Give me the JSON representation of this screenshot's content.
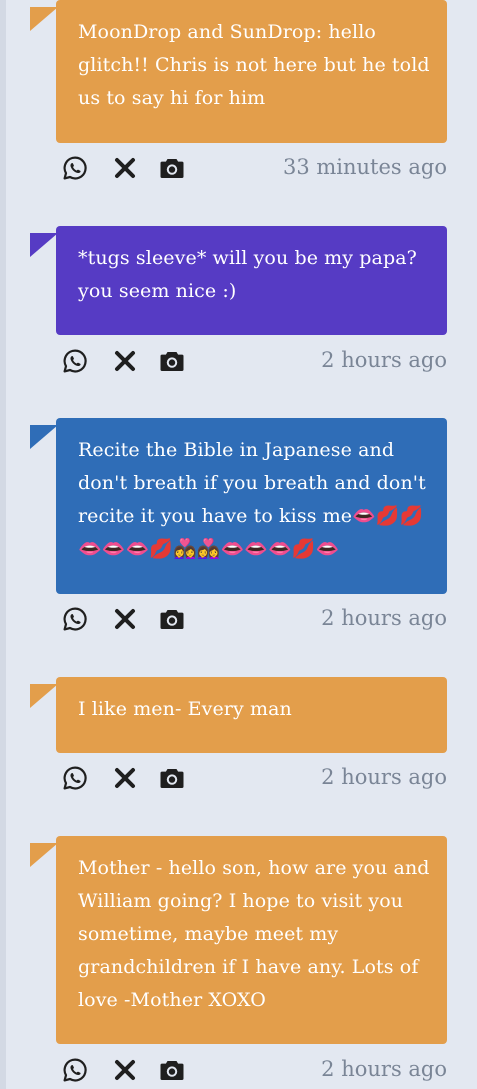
{
  "colors": {
    "background": "#e3e8f1",
    "orange": "#e39e4b",
    "purple": "#563bc4",
    "blue": "#2f6db7",
    "icon": "#1f1f1f",
    "timestamp": "#7a8596"
  },
  "posts": [
    {
      "color": "orange",
      "text": "MoonDrop and SunDrop: hello glitch!! Chris is not here but he told us to say hi for him",
      "time": "33 minutes ago"
    },
    {
      "color": "purple",
      "text": "*tugs sleeve* will you be my papa? you seem nice :)",
      "time": "2 hours ago"
    },
    {
      "color": "blue",
      "text": "Recite the Bible in Japanese and don't breath if you breath and don't recite it you have to kiss me👄💋💋👄👄👄💋👩‍❤️‍👩👩‍❤️‍👩👄👄👄💋👄",
      "time": "2 hours ago"
    },
    {
      "color": "orange",
      "text": "I like men- Every man",
      "time": "2 hours ago"
    },
    {
      "color": "orange",
      "text": "Mother - hello son, how are you and William going? I hope to visit you sometime, maybe meet my grandchildren if I have any. Lots of love -Mother XOXO",
      "time": "2 hours ago"
    }
  ],
  "actions": {
    "whatsapp_icon": "whatsapp-icon",
    "delete_icon": "close-icon",
    "screenshot_icon": "camera-icon"
  }
}
